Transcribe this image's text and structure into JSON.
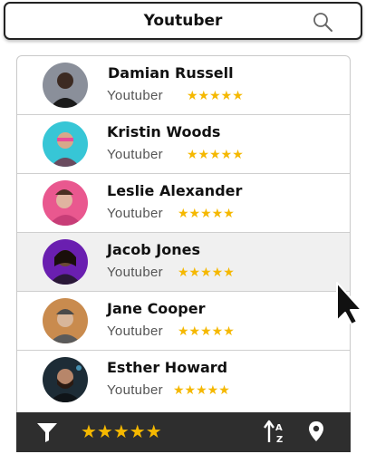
{
  "search": {
    "query": "Youtuber"
  },
  "people": [
    {
      "name": "Damian Russell",
      "role": "Youtuber",
      "stars": "★★★★★",
      "rating": 5
    },
    {
      "name": "Kristin Woods",
      "role": "Youtuber",
      "stars": "★★★★★",
      "rating": 5
    },
    {
      "name": "Leslie Alexander",
      "role": "Youtuber",
      "stars": "★★★★★",
      "rating": 5
    },
    {
      "name": "Jacob Jones",
      "role": "Youtuber",
      "stars": "★★★★★",
      "rating": 5,
      "selected": true
    },
    {
      "name": "Jane Cooper",
      "role": "Youtuber",
      "stars": "★★★★★",
      "rating": 5
    },
    {
      "name": "Esther Howard",
      "role": "Youtuber",
      "stars": "★★★★★",
      "rating": 5
    }
  ],
  "filter_bar": {
    "stars": "★★★★★",
    "rating_filter": 5
  },
  "icons": {
    "search": "search-icon",
    "filter": "filter-icon",
    "sort": "sort-alpha-icon",
    "location": "location-pin-icon",
    "cursor": "mouse-cursor-icon"
  },
  "colors": {
    "star": "#f5b800",
    "bar": "#2e2e2e",
    "selected_row": "#f0f0f0"
  }
}
